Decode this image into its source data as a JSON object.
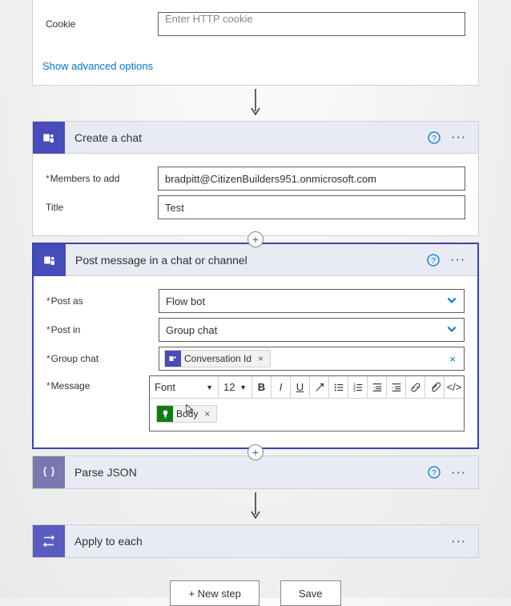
{
  "card0": {
    "cookie_label": "Cookie",
    "cookie_placeholder": "Enter HTTP cookie",
    "advanced_link": "Show advanced options"
  },
  "card1": {
    "title": "Create a chat",
    "members_label": "Members to add",
    "members_value": "bradpitt@CitizenBuilders951.onmicrosoft.com",
    "title_label": "Title",
    "title_value": "Test"
  },
  "card2": {
    "title": "Post message in a chat or channel",
    "post_as_label": "Post as",
    "post_as_value": "Flow bot",
    "post_in_label": "Post in",
    "post_in_value": "Group chat",
    "group_chat_label": "Group chat",
    "group_chat_token": "Conversation Id",
    "message_label": "Message",
    "font_label": "Font",
    "font_size": "12",
    "body_token": "Body"
  },
  "card3": {
    "title": "Parse JSON"
  },
  "card4": {
    "title": "Apply to each"
  },
  "footer": {
    "new_step": "+ New step",
    "save": "Save"
  }
}
